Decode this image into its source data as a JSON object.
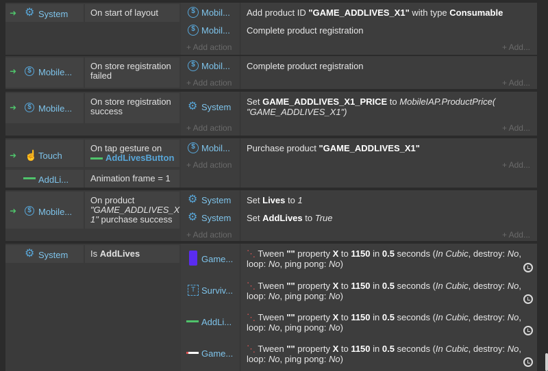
{
  "events": [
    {
      "object": "System",
      "icon": "gear-icon",
      "condition": "On start of layout",
      "actions": [
        {
          "object": "Mobil...",
          "icon": "mobile-iap-icon",
          "parts": [
            "Add product ID ",
            "\"GAME_ADDLIVES_X1\"",
            " with type ",
            "Consumable"
          ]
        },
        {
          "object": "Mobil...",
          "icon": "mobile-iap-icon",
          "text": "Complete product registration"
        }
      ]
    },
    {
      "object": "Mobile...",
      "icon": "mobile-iap-icon",
      "condition": "On store registration failed",
      "actions": [
        {
          "object": "Mobil...",
          "icon": "mobile-iap-icon",
          "text": "Complete product registration"
        }
      ]
    },
    {
      "object": "Mobile...",
      "icon": "mobile-iap-icon",
      "condition": "On store registration success",
      "actions": [
        {
          "object": "System",
          "icon": "gear-icon",
          "parts": [
            "Set ",
            "GAME_ADDLIVES_X1_PRICE",
            " to ",
            "MobileIAP.ProductPrice(",
            "\"GAME_ADDLIVES_X1\")"
          ]
        }
      ]
    },
    {
      "object": "Touch",
      "icon": "touch-icon",
      "condition_parts": [
        "On tap gesture on",
        "AddLivesButton"
      ],
      "object2": "AddLi...",
      "condition2": "Animation frame = 1",
      "actions": [
        {
          "object": "Mobil...",
          "icon": "mobile-iap-icon",
          "parts": [
            "Purchase product ",
            "\"GAME_ADDLIVES_X1\""
          ]
        }
      ]
    },
    {
      "object": "Mobile...",
      "icon": "mobile-iap-icon",
      "condition_parts": [
        "On product",
        "\"GAME_ADDLIVES_X",
        "1\"",
        " purchase success"
      ],
      "actions": [
        {
          "object": "System",
          "icon": "gear-icon",
          "parts": [
            "Set ",
            "Lives",
            " to ",
            "1"
          ]
        },
        {
          "object": "System",
          "icon": "gear-icon",
          "parts": [
            "Set ",
            "AddLives",
            " to ",
            "True"
          ]
        }
      ]
    },
    {
      "object": "System",
      "icon": "gear-icon",
      "condition_parts": [
        "Is ",
        "AddLives"
      ],
      "actions": [
        {
          "object": "Game...",
          "icon": "sprite-purple-icon",
          "tween": [
            "Tween ",
            "\"\"",
            " property ",
            "X",
            " to ",
            "1150",
            " in ",
            "0.5",
            " seconds (",
            "In Cubic",
            ", destroy: ",
            "No",
            ",",
            "loop: ",
            "No",
            ", ping pong: ",
            "No",
            ")"
          ]
        },
        {
          "object": "Surviv...",
          "icon": "text-object-icon",
          "tween": [
            "Tween ",
            "\"\"",
            " property ",
            "X",
            " to ",
            "1150",
            " in ",
            "0.5",
            " seconds (",
            "In Cubic",
            ", destroy: ",
            "No",
            ",",
            "loop: ",
            "No",
            ", ping pong: ",
            "No",
            ")"
          ]
        },
        {
          "object": "AddLi...",
          "icon": "green-bar-icon",
          "tween": [
            "Tween ",
            "\"\"",
            " property ",
            "X",
            " to ",
            "1150",
            " in ",
            "0.5",
            " seconds (",
            "In Cubic",
            ", destroy: ",
            "No",
            ",",
            "loop: ",
            "No",
            ", ping pong: ",
            "No",
            ")"
          ]
        },
        {
          "object": "Game...",
          "icon": "white-bar-icon",
          "tween": [
            "Tween ",
            "\"\"",
            " property ",
            "X",
            " to ",
            "1150",
            " in ",
            "0.5",
            " seconds (",
            "In Cubic",
            ", destroy: ",
            "No",
            ",",
            "loop: ",
            "No",
            ", ping pong: ",
            "No",
            ")"
          ]
        }
      ]
    }
  ],
  "labels": {
    "add_action": "+ Add action",
    "add_more": "+ Add...",
    "arrow": "➜"
  },
  "colors": {
    "object_name": "#7ec3ea",
    "trigger_arrow": "#4fc36b"
  }
}
